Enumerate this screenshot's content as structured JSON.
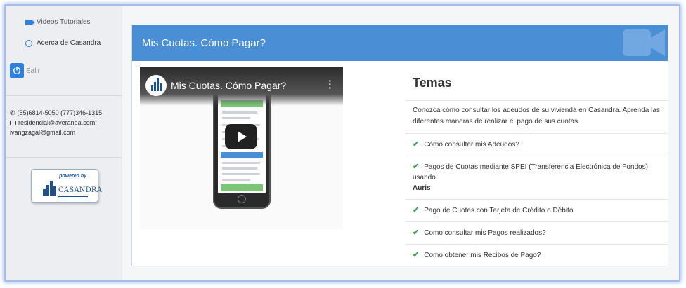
{
  "sidebar": {
    "items": [
      {
        "label": "Videos Tutoriales",
        "icon": "video-camera-icon"
      },
      {
        "label": "Acerca de Casandra",
        "icon": "smile-icon"
      }
    ],
    "logout_label": "Salir",
    "contact": {
      "phones": "(55)6814-5050 (777)346-1315",
      "email_line1": "residencial@averanda.com;",
      "email_line2": "ivangzagal@gmail.com"
    },
    "powered": {
      "caption": "powered by",
      "brand": "CASANDRA"
    }
  },
  "panel": {
    "title": "Mis Cuotas. Cómo Pagar?",
    "video": {
      "title": "Mis Cuotas. Cómo Pagar?"
    },
    "topics": {
      "heading": "Temas",
      "intro": "Conozca cómo consultar los adeudos de su vivienda en Casandra. Aprenda las diferentes maneras de realizar el pago de sus cuotas.",
      "items": [
        {
          "text": "Cómo consultar mis Adeudos?",
          "bold": ""
        },
        {
          "text": "Pagos de Cuotas mediante SPEI (Transferencia Electrónica de Fondos) usando",
          "bold": "Auris"
        },
        {
          "text": "Pago de Cuotas con Tarjeta de Crédito o Débito",
          "bold": ""
        },
        {
          "text": "Como consultar mis Pagos realizados?",
          "bold": ""
        },
        {
          "text": "Como obtener mis Recibos de Pago?",
          "bold": ""
        }
      ]
    }
  },
  "colors": {
    "accent": "#4a8fd6",
    "check": "#3aa556",
    "brand": "#1e4f8f"
  }
}
